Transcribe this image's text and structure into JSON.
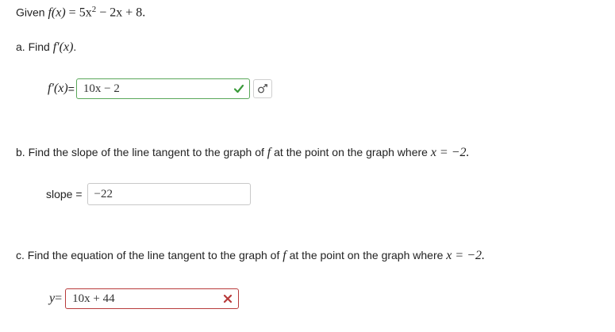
{
  "given": {
    "text": "Given ",
    "fn": "f(x)",
    "expr_a": " = 5x",
    "expr_exp": "2",
    "expr_b": " − 2x + 8."
  },
  "part_a": {
    "prompt": "a. Find ",
    "prompt_math": "f′(x)",
    "prompt_end": ".",
    "label_math": "f′(x)",
    "label_eq": "=",
    "answer": "10x − 2",
    "status_icon": "check-icon",
    "status_color": "#3a9a3a",
    "preview_icon": "equation-preview-icon"
  },
  "part_b": {
    "prompt_a": "b. Find the slope of the line tangent to the graph of ",
    "prompt_f": "f",
    "prompt_b": " at the point on the graph where ",
    "prompt_math": "x = −2.",
    "label": "slope =",
    "answer": "−22"
  },
  "part_c": {
    "prompt_a": "c. Find the equation of the line tangent to the graph of ",
    "prompt_f": "f",
    "prompt_b": " at the point on the graph where ",
    "prompt_math": "x = −2.",
    "label_math": "y",
    "label_eq": " =",
    "answer": "10x + 44",
    "status_icon": "cross-icon",
    "status_color": "#b83a3a"
  }
}
